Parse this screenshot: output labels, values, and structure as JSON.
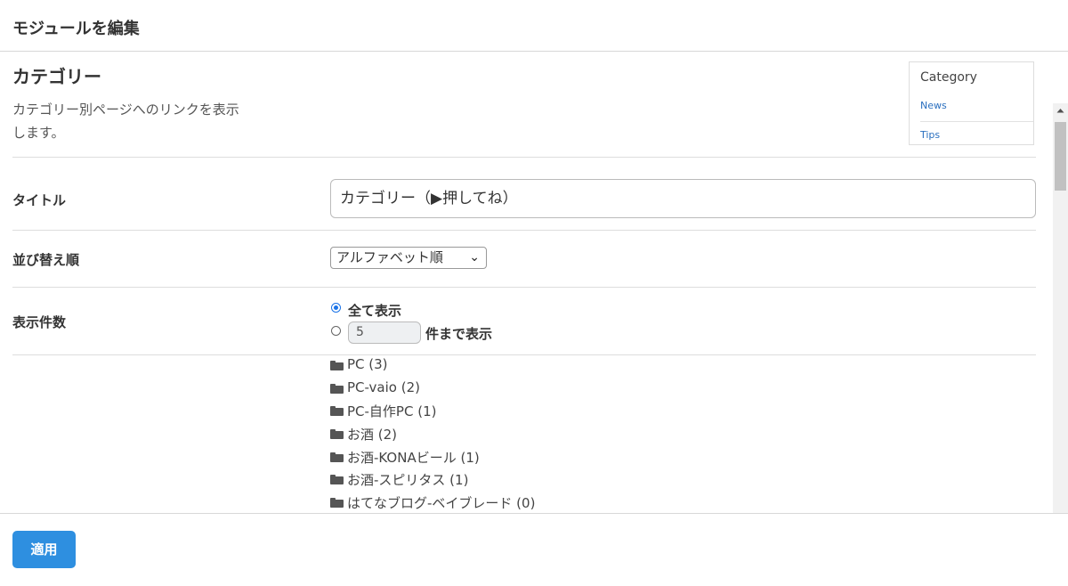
{
  "dialog": {
    "title": "モジュールを編集"
  },
  "module": {
    "title": "カテゴリー",
    "description_line1": "カテゴリー別ページへのリンクを表示",
    "description_line2": "します。"
  },
  "preview": {
    "title": "Category",
    "links": [
      "News",
      "Tips"
    ]
  },
  "fields": {
    "title": {
      "label": "タイトル",
      "value": "カテゴリー（▶押してね）"
    },
    "sort": {
      "label": "並び替え順",
      "selected": "アルファベット順"
    },
    "count": {
      "label": "表示件数",
      "option_all": "全て表示",
      "option_limit_suffix": "件まで表示",
      "limit_value": "5",
      "selected": "all"
    }
  },
  "categories": [
    "PC (3)",
    "PC-vaio (2)",
    "PC-自作PC (1)",
    "お酒 (2)",
    "お酒-KONAビール (1)",
    "お酒-スピリタス (1)",
    "はてなブログ-ベイブレード (0)"
  ],
  "footer": {
    "apply_label": "適用"
  },
  "colors": {
    "accent": "#2e8fe0",
    "link": "#2a6fbf",
    "radio": "#1a73e8"
  }
}
